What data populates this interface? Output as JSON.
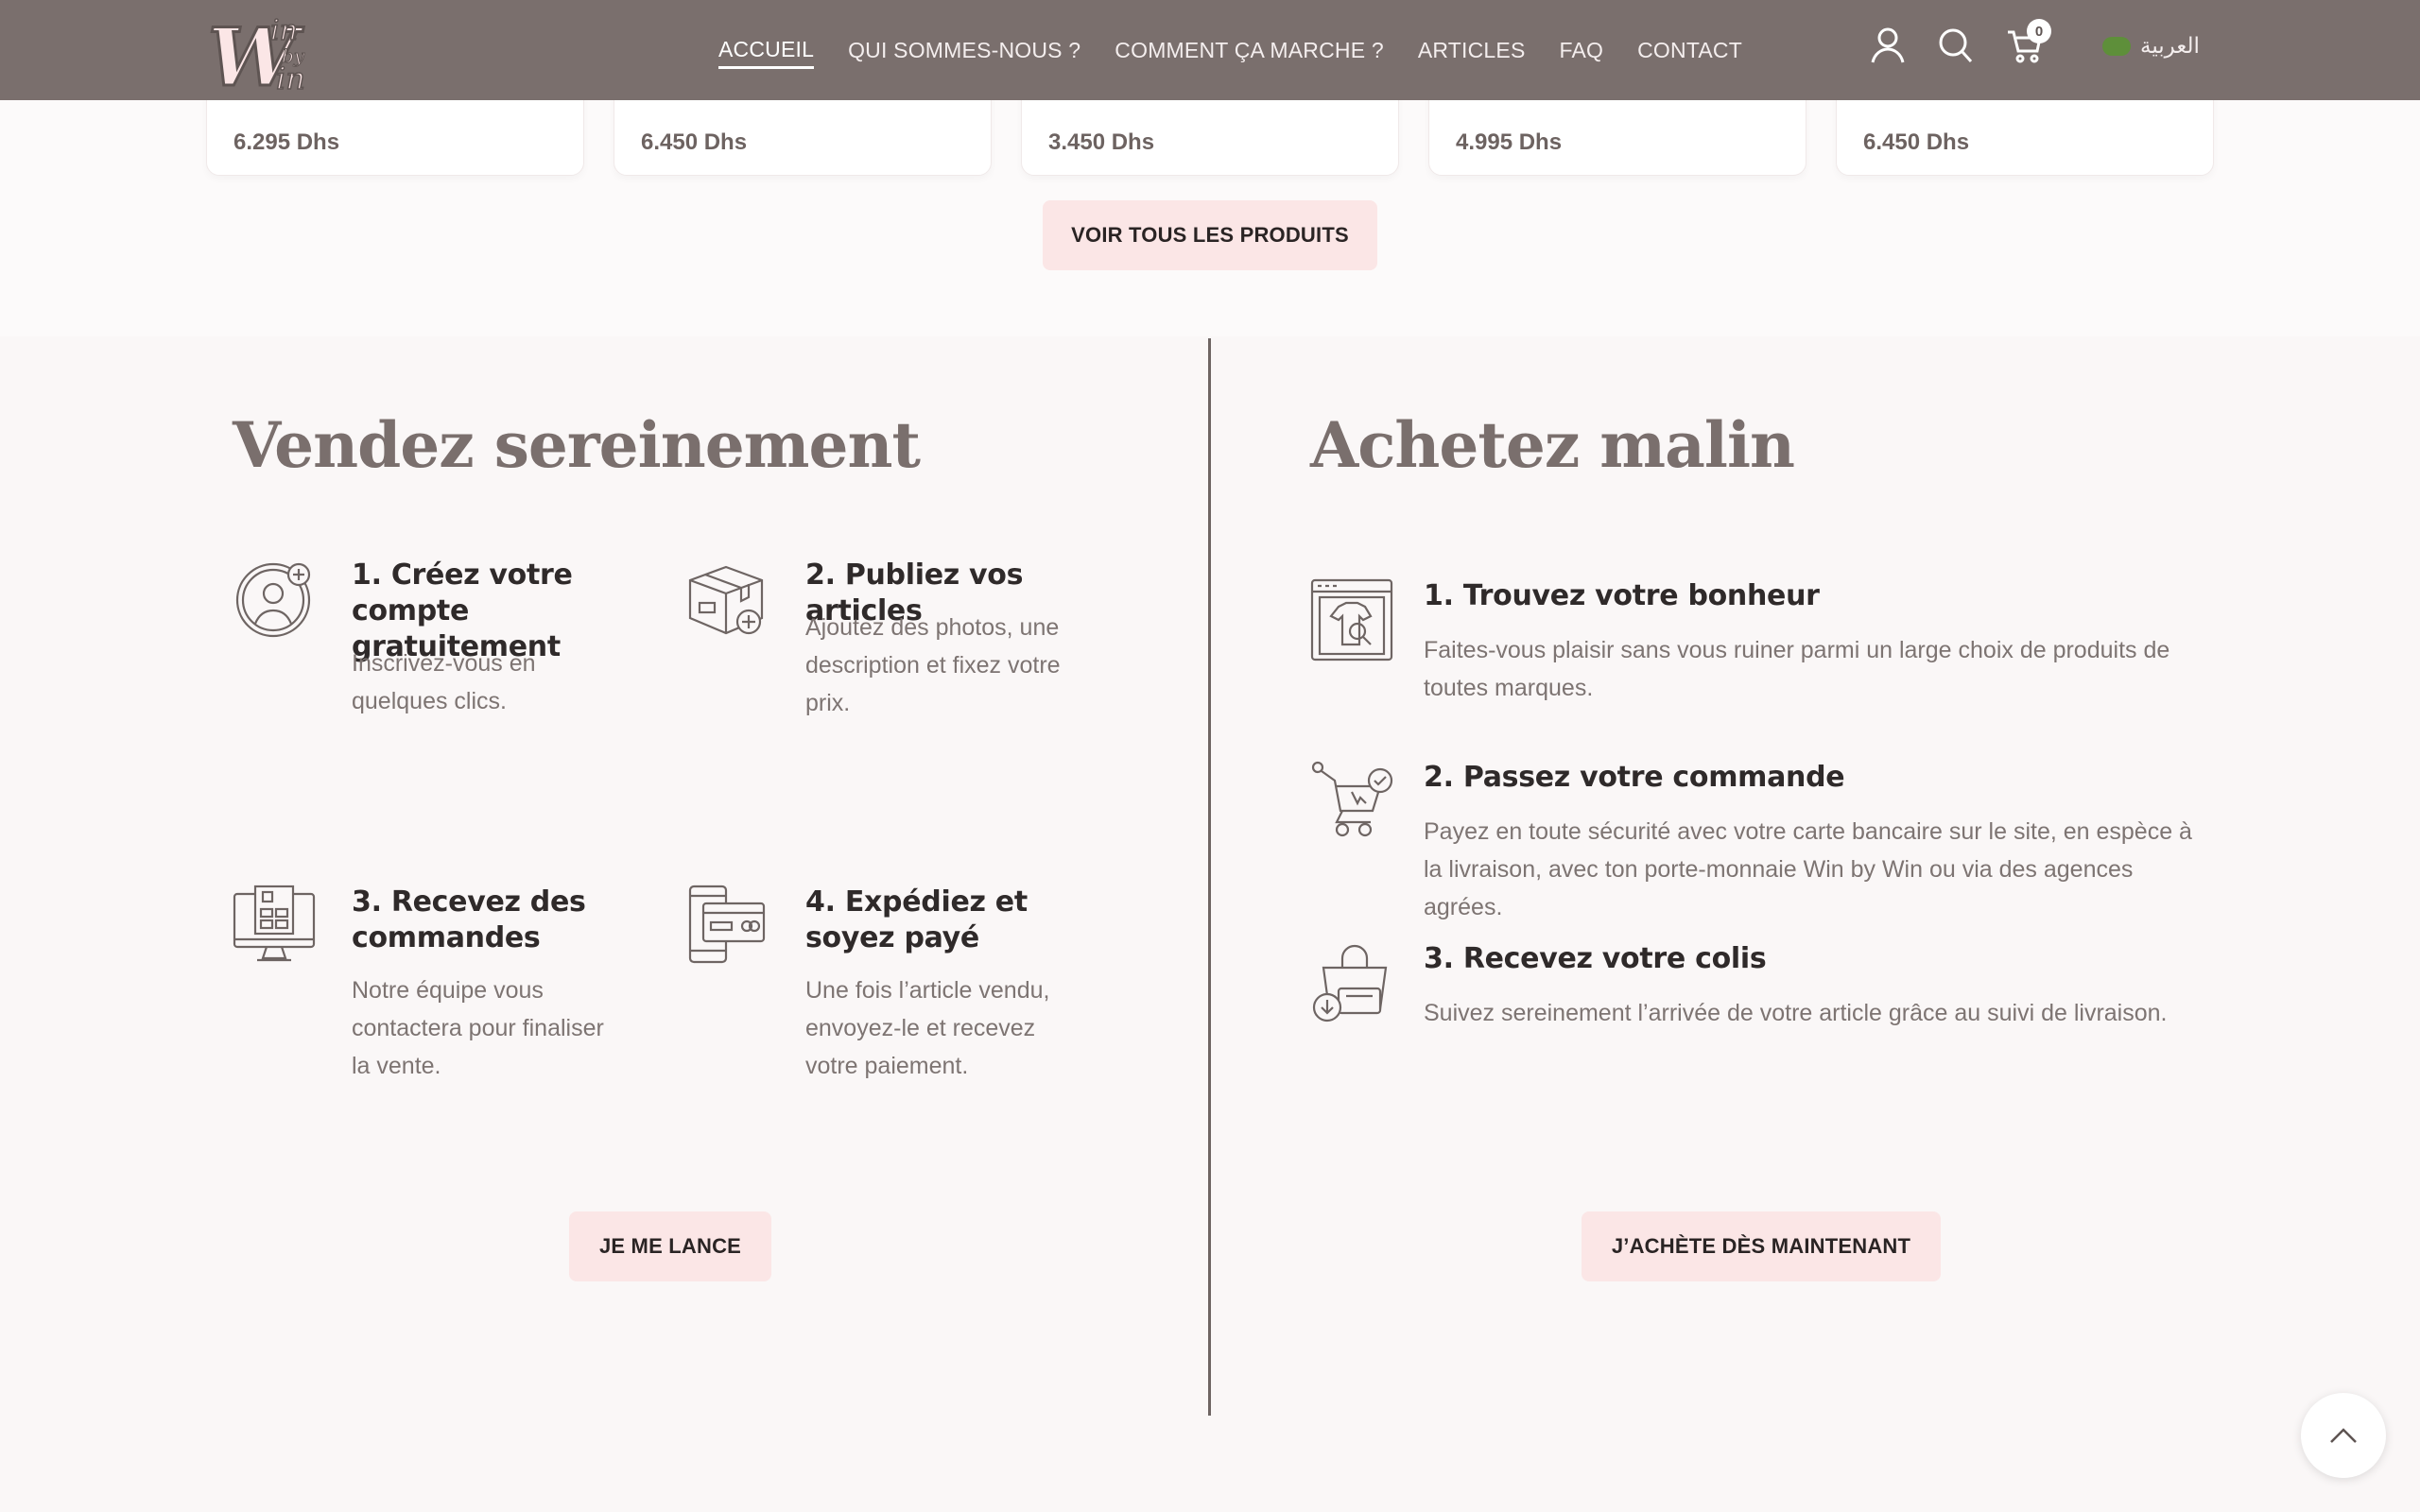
{
  "header": {
    "nav": [
      {
        "label": "ACCUEIL",
        "active": true
      },
      {
        "label": "QUI SOMMES-NOUS ?"
      },
      {
        "label": "COMMENT ÇA MARCHE ?"
      },
      {
        "label": "ARTICLES"
      },
      {
        "label": "FAQ"
      },
      {
        "label": "CONTACT"
      }
    ],
    "cart_count": "0",
    "language": "العربية"
  },
  "products": {
    "prices": [
      "6.295 Dhs",
      "6.450 Dhs",
      "3.450 Dhs",
      "4.995 Dhs",
      "6.450 Dhs"
    ],
    "view_all": "VOIR TOUS LES PRODUITS"
  },
  "sell": {
    "title": "Vendez sereinement",
    "steps": [
      {
        "title": "1. Créez votre compte gratuitement",
        "desc": "Inscrivez-vous en quelques clics.",
        "icon": "user-add-icon"
      },
      {
        "title": "2. Publiez vos articles",
        "desc": "Ajoutez des photos, une description et fixez votre prix.",
        "icon": "box-add-icon"
      },
      {
        "title": "3. Recevez des commandes",
        "desc": "Notre équipe vous contactera pour finaliser la vente.",
        "icon": "monitor-order-icon"
      },
      {
        "title": "4. Expédiez et soyez payé",
        "desc": "Une fois l’article vendu, envoyez-le et recevez votre paiement.",
        "icon": "phone-card-icon"
      }
    ],
    "cta": "JE ME LANCE"
  },
  "buy": {
    "title": "Achetez malin",
    "steps": [
      {
        "title": "1. Trouvez votre bonheur",
        "desc": "Faites-vous plaisir sans vous ruiner parmi un large choix de produits de toutes marques.",
        "icon": "browser-shirt-icon"
      },
      {
        "title": "2. Passez votre commande",
        "desc": "Payez en toute sécurité avec votre carte bancaire sur le site, en espèce à la livraison, avec ton porte-monnaie Win by Win ou via des agences agrées.",
        "icon": "cart-check-icon"
      },
      {
        "title": "3. Recevez votre colis",
        "desc": "Suivez sereinement l’arrivée de votre article grâce au suivi de livraison.",
        "icon": "shopping-bag-download-icon"
      }
    ],
    "cta": "J’ACHÈTE DÈS MAINTENANT"
  },
  "colors": {
    "header": "#7a6f6d",
    "accent_button": "#fbe6e6",
    "heading": "#7a6f6d"
  }
}
